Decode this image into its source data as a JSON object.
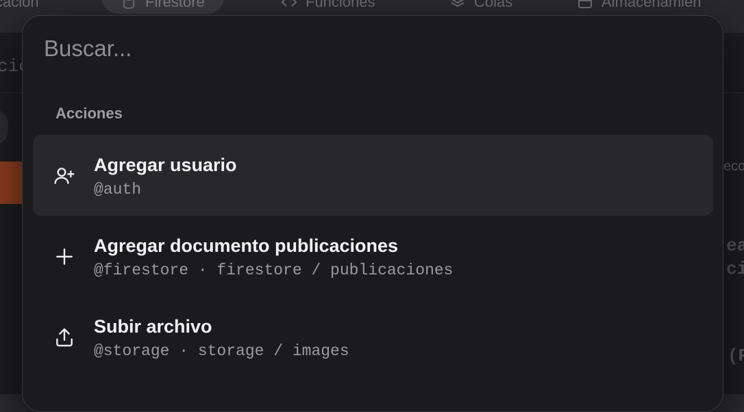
{
  "background": {
    "nav_tabs": [
      {
        "label": "ticación",
        "icon": "none"
      },
      {
        "label": "Firestore",
        "icon": "database-icon"
      },
      {
        "label": "Funciones",
        "icon": "code-icon"
      },
      {
        "label": "Colas",
        "icon": "layers-icon"
      },
      {
        "label": "Almacenamien",
        "icon": "archive-icon"
      }
    ],
    "left_text": "cio",
    "right_text_1": "eco",
    "right_text_2": "ear",
    "right_text_3": "cia",
    "right_text_4": "(P"
  },
  "palette": {
    "search_placeholder": "Buscar...",
    "group_label": "Acciones",
    "items": [
      {
        "title": "Agregar usuario",
        "meta": "@auth",
        "icon": "user-plus-icon",
        "selected": true
      },
      {
        "title": "Agregar documento publicaciones",
        "meta": "@firestore · firestore / publicaciones",
        "icon": "plus-icon",
        "selected": false
      },
      {
        "title": "Subir archivo",
        "meta": "@storage · storage / images",
        "icon": "upload-icon",
        "selected": false
      }
    ]
  },
  "colors": {
    "palette_bg": "#1b1b1e",
    "selected_item_bg": "#28282c",
    "accent_orange": "#8a3b20"
  }
}
